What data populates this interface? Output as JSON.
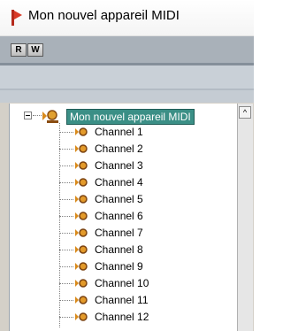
{
  "window": {
    "title": "Mon nouvel appareil MIDI"
  },
  "toolbar": {
    "read_label": "R",
    "write_label": "W"
  },
  "tree": {
    "root_label": "Mon nouvel appareil MIDI",
    "channels": [
      "Channel 1",
      "Channel 2",
      "Channel 3",
      "Channel 4",
      "Channel 5",
      "Channel 6",
      "Channel 7",
      "Channel 8",
      "Channel 9",
      "Channel 10",
      "Channel 11",
      "Channel 12"
    ]
  },
  "scrollbar": {
    "up_glyph": "^"
  },
  "colors": {
    "title_icon": "#c83222",
    "selection": "#3b8f86",
    "channel_icon": "#d98a1b",
    "toolbar": "#a9b1b9"
  },
  "icons": {
    "title": "midi-device-red-flag",
    "root": "midi-device-icon",
    "channel": "midi-channel-icon"
  }
}
